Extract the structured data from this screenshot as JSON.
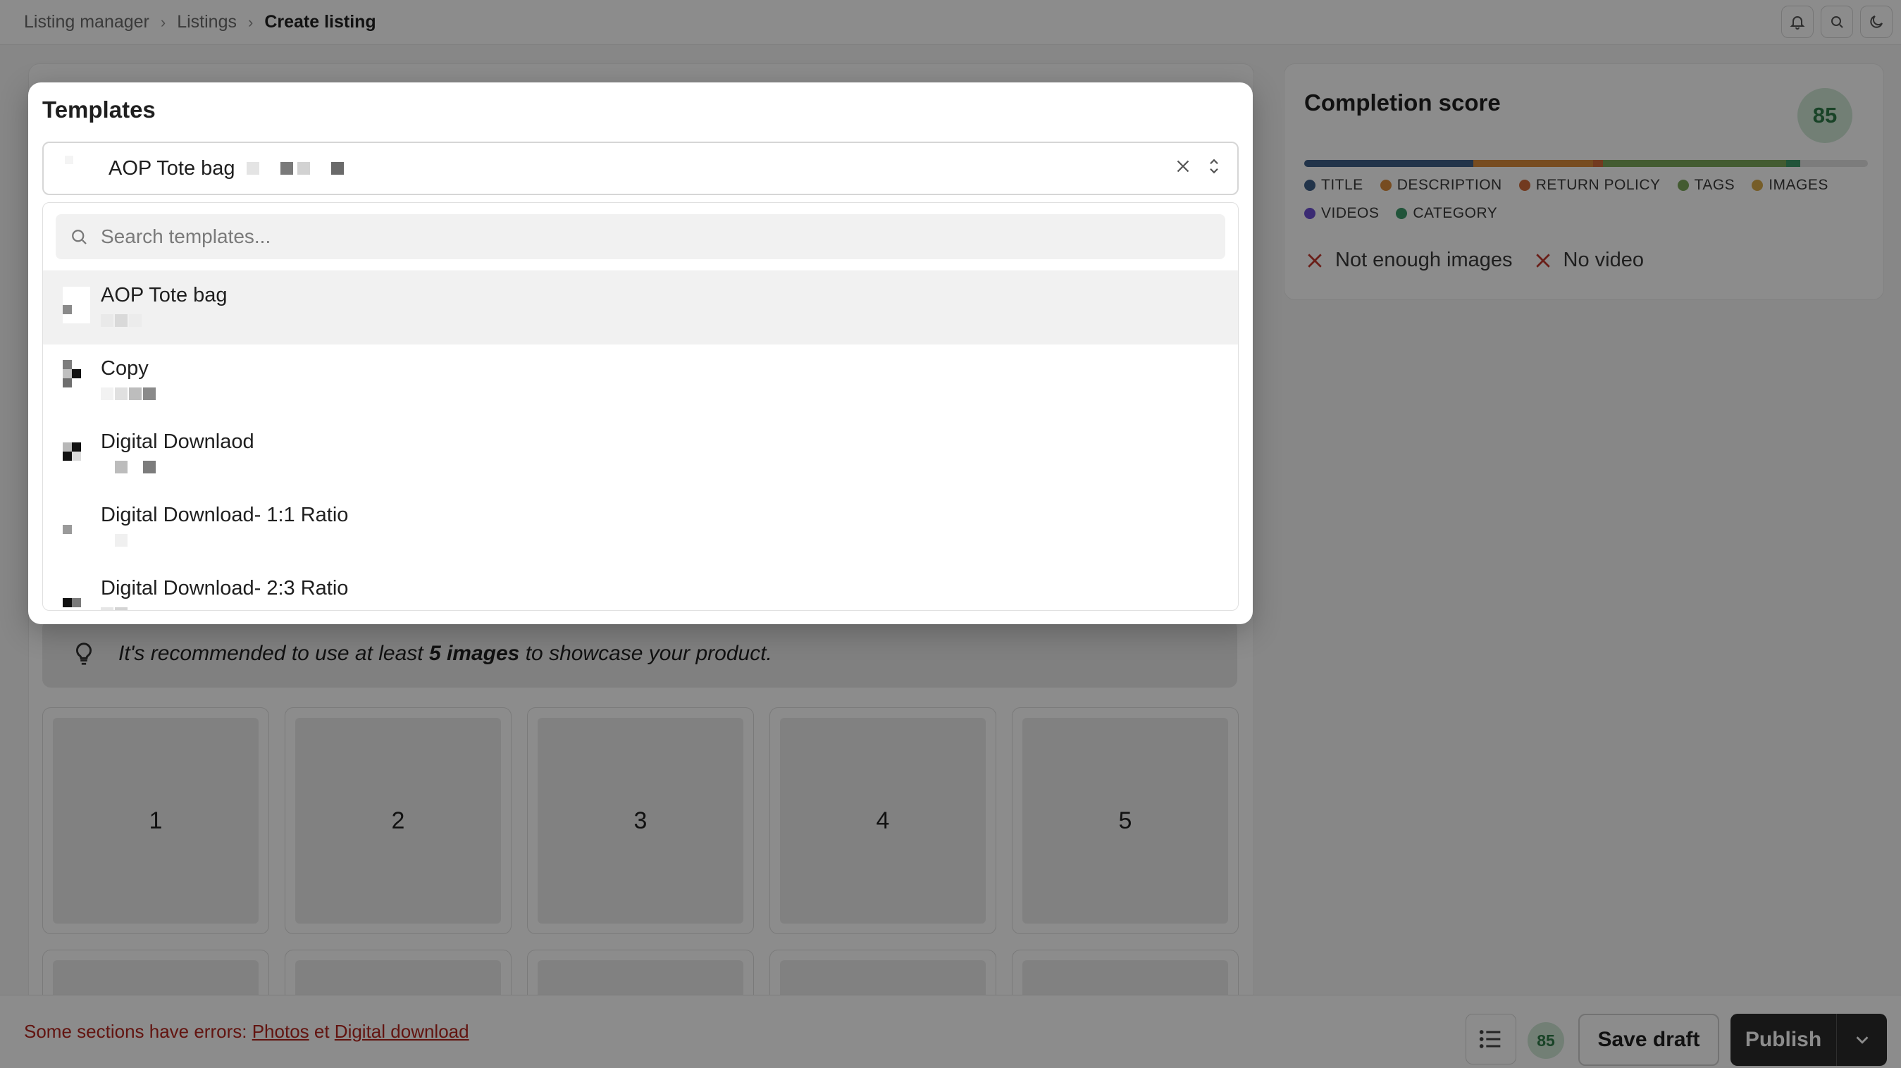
{
  "breadcrumb": {
    "items": [
      "Listing manager",
      "Listings"
    ],
    "current": "Create listing"
  },
  "topbar_icons": [
    "bell-icon",
    "search-icon",
    "moon-icon"
  ],
  "images_hint": {
    "prefix": "It's recommended to use at least ",
    "bold": "5 images",
    "suffix": " to showcase your product."
  },
  "image_slots": [
    "1",
    "2",
    "3",
    "4",
    "5"
  ],
  "completion": {
    "title": "Completion score",
    "score": "85",
    "legend": [
      {
        "label": "TITLE",
        "color": "#3f5f87"
      },
      {
        "label": "DESCRIPTION",
        "color": "#d98a3b"
      },
      {
        "label": "RETURN POLICY",
        "color": "#cf6a3a"
      },
      {
        "label": "TAGS",
        "color": "#7aa65a"
      },
      {
        "label": "IMAGES",
        "color": "#d8a94a"
      },
      {
        "label": "VIDEOS",
        "color": "#6c4fd1"
      },
      {
        "label": "CATEGORY",
        "color": "#3c9a6a"
      }
    ],
    "issues": [
      "Not enough images",
      "No video"
    ]
  },
  "bottom": {
    "error_prefix": "Some sections have errors: ",
    "error_link_1": "Photos",
    "error_join": " et ",
    "error_link_2": "Digital download",
    "score": "85",
    "save_label": "Save draft",
    "publish_label": "Publish"
  },
  "templates_modal": {
    "title": "Templates",
    "selected_value": "AOP Tote bag",
    "search_placeholder": "Search templates...",
    "options": [
      {
        "label": "AOP Tote bag"
      },
      {
        "label": "Copy"
      },
      {
        "label": "Digital Downlaod"
      },
      {
        "label": "Digital Download- 1:1 Ratio"
      },
      {
        "label": "Digital Download- 2:3 Ratio"
      }
    ]
  }
}
